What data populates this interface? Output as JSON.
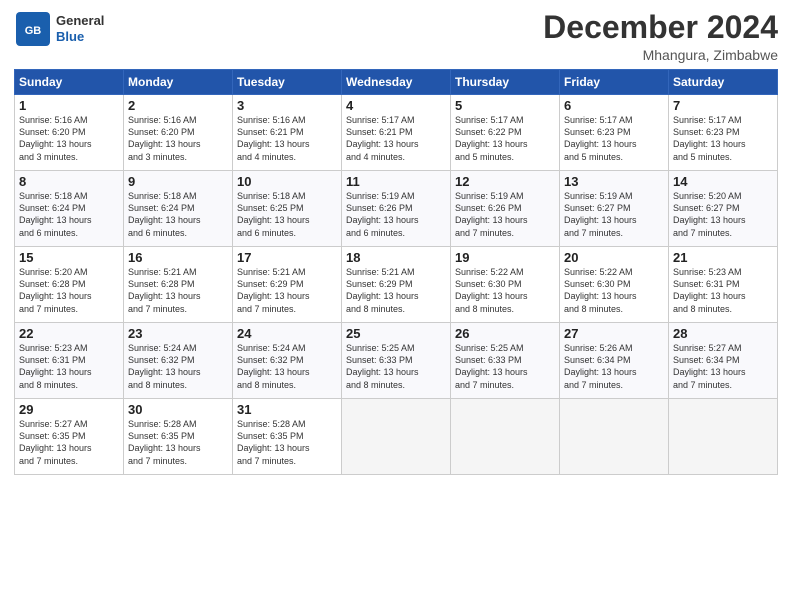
{
  "header": {
    "logo_general": "General",
    "logo_blue": "Blue",
    "month_title": "December 2024",
    "location": "Mhangura, Zimbabwe"
  },
  "days_of_week": [
    "Sunday",
    "Monday",
    "Tuesday",
    "Wednesday",
    "Thursday",
    "Friday",
    "Saturday"
  ],
  "weeks": [
    [
      {
        "day": 1,
        "info": "Sunrise: 5:16 AM\nSunset: 6:20 PM\nDaylight: 13 hours\nand 3 minutes."
      },
      {
        "day": 2,
        "info": "Sunrise: 5:16 AM\nSunset: 6:20 PM\nDaylight: 13 hours\nand 3 minutes."
      },
      {
        "day": 3,
        "info": "Sunrise: 5:16 AM\nSunset: 6:21 PM\nDaylight: 13 hours\nand 4 minutes."
      },
      {
        "day": 4,
        "info": "Sunrise: 5:17 AM\nSunset: 6:21 PM\nDaylight: 13 hours\nand 4 minutes."
      },
      {
        "day": 5,
        "info": "Sunrise: 5:17 AM\nSunset: 6:22 PM\nDaylight: 13 hours\nand 5 minutes."
      },
      {
        "day": 6,
        "info": "Sunrise: 5:17 AM\nSunset: 6:23 PM\nDaylight: 13 hours\nand 5 minutes."
      },
      {
        "day": 7,
        "info": "Sunrise: 5:17 AM\nSunset: 6:23 PM\nDaylight: 13 hours\nand 5 minutes."
      }
    ],
    [
      {
        "day": 8,
        "info": "Sunrise: 5:18 AM\nSunset: 6:24 PM\nDaylight: 13 hours\nand 6 minutes."
      },
      {
        "day": 9,
        "info": "Sunrise: 5:18 AM\nSunset: 6:24 PM\nDaylight: 13 hours\nand 6 minutes."
      },
      {
        "day": 10,
        "info": "Sunrise: 5:18 AM\nSunset: 6:25 PM\nDaylight: 13 hours\nand 6 minutes."
      },
      {
        "day": 11,
        "info": "Sunrise: 5:19 AM\nSunset: 6:26 PM\nDaylight: 13 hours\nand 6 minutes."
      },
      {
        "day": 12,
        "info": "Sunrise: 5:19 AM\nSunset: 6:26 PM\nDaylight: 13 hours\nand 7 minutes."
      },
      {
        "day": 13,
        "info": "Sunrise: 5:19 AM\nSunset: 6:27 PM\nDaylight: 13 hours\nand 7 minutes."
      },
      {
        "day": 14,
        "info": "Sunrise: 5:20 AM\nSunset: 6:27 PM\nDaylight: 13 hours\nand 7 minutes."
      }
    ],
    [
      {
        "day": 15,
        "info": "Sunrise: 5:20 AM\nSunset: 6:28 PM\nDaylight: 13 hours\nand 7 minutes."
      },
      {
        "day": 16,
        "info": "Sunrise: 5:21 AM\nSunset: 6:28 PM\nDaylight: 13 hours\nand 7 minutes."
      },
      {
        "day": 17,
        "info": "Sunrise: 5:21 AM\nSunset: 6:29 PM\nDaylight: 13 hours\nand 7 minutes."
      },
      {
        "day": 18,
        "info": "Sunrise: 5:21 AM\nSunset: 6:29 PM\nDaylight: 13 hours\nand 8 minutes."
      },
      {
        "day": 19,
        "info": "Sunrise: 5:22 AM\nSunset: 6:30 PM\nDaylight: 13 hours\nand 8 minutes."
      },
      {
        "day": 20,
        "info": "Sunrise: 5:22 AM\nSunset: 6:30 PM\nDaylight: 13 hours\nand 8 minutes."
      },
      {
        "day": 21,
        "info": "Sunrise: 5:23 AM\nSunset: 6:31 PM\nDaylight: 13 hours\nand 8 minutes."
      }
    ],
    [
      {
        "day": 22,
        "info": "Sunrise: 5:23 AM\nSunset: 6:31 PM\nDaylight: 13 hours\nand 8 minutes."
      },
      {
        "day": 23,
        "info": "Sunrise: 5:24 AM\nSunset: 6:32 PM\nDaylight: 13 hours\nand 8 minutes."
      },
      {
        "day": 24,
        "info": "Sunrise: 5:24 AM\nSunset: 6:32 PM\nDaylight: 13 hours\nand 8 minutes."
      },
      {
        "day": 25,
        "info": "Sunrise: 5:25 AM\nSunset: 6:33 PM\nDaylight: 13 hours\nand 8 minutes."
      },
      {
        "day": 26,
        "info": "Sunrise: 5:25 AM\nSunset: 6:33 PM\nDaylight: 13 hours\nand 7 minutes."
      },
      {
        "day": 27,
        "info": "Sunrise: 5:26 AM\nSunset: 6:34 PM\nDaylight: 13 hours\nand 7 minutes."
      },
      {
        "day": 28,
        "info": "Sunrise: 5:27 AM\nSunset: 6:34 PM\nDaylight: 13 hours\nand 7 minutes."
      }
    ],
    [
      {
        "day": 29,
        "info": "Sunrise: 5:27 AM\nSunset: 6:35 PM\nDaylight: 13 hours\nand 7 minutes."
      },
      {
        "day": 30,
        "info": "Sunrise: 5:28 AM\nSunset: 6:35 PM\nDaylight: 13 hours\nand 7 minutes."
      },
      {
        "day": 31,
        "info": "Sunrise: 5:28 AM\nSunset: 6:35 PM\nDaylight: 13 hours\nand 7 minutes."
      },
      {
        "day": null,
        "info": ""
      },
      {
        "day": null,
        "info": ""
      },
      {
        "day": null,
        "info": ""
      },
      {
        "day": null,
        "info": ""
      }
    ]
  ]
}
